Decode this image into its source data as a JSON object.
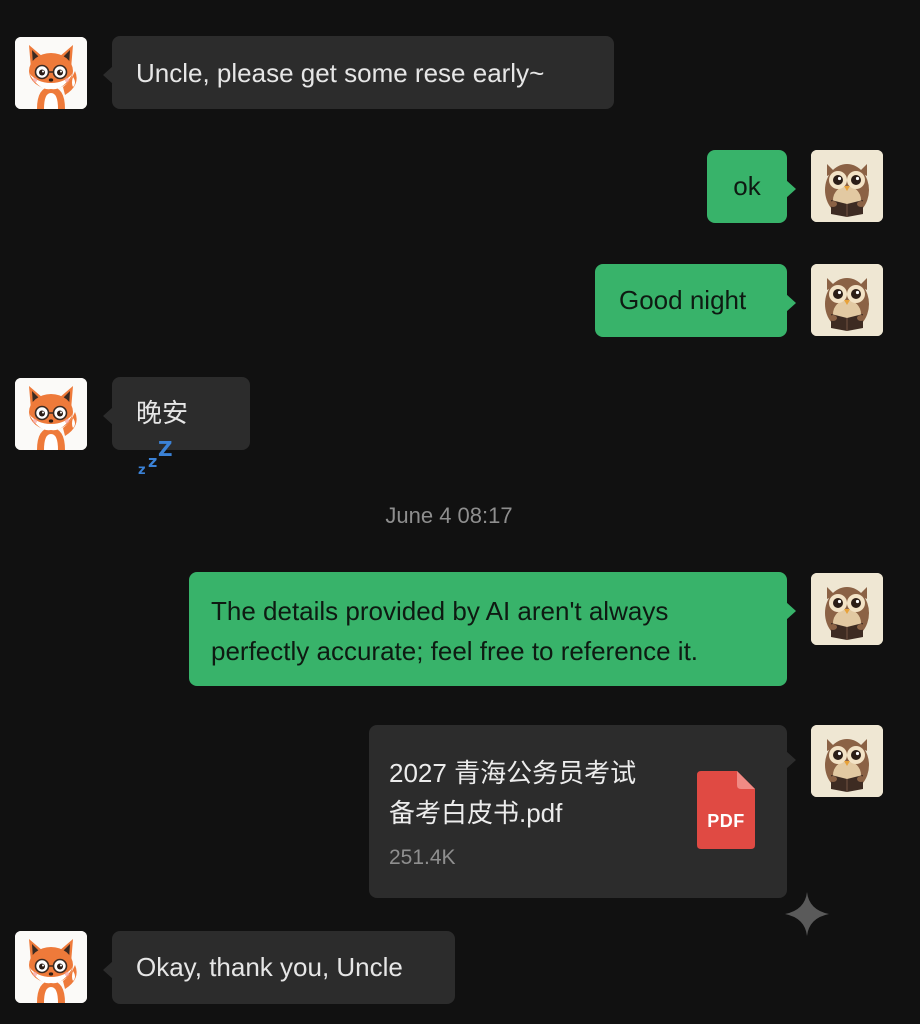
{
  "messages": [
    {
      "side": "in",
      "text": "Uncle, please get some rese early~"
    },
    {
      "side": "out",
      "text": "ok"
    },
    {
      "side": "out",
      "text": "Good night"
    },
    {
      "side": "in",
      "text": "晚安",
      "emoji": "zzz"
    },
    {
      "side": "out",
      "text_lines": [
        "The details provided by AI aren't always",
        "perfectly accurate; feel free to reference it."
      ]
    },
    {
      "side": "out",
      "file": {
        "name_lines": [
          "2027 青海公务员考试",
          "备考白皮书.pdf"
        ],
        "size": "251.4K",
        "type_label": "PDF"
      }
    },
    {
      "side": "in",
      "text": "Okay, thank you, Uncle"
    }
  ],
  "timestamp": "June 4 08:17",
  "zzz": [
    "z",
    "z",
    "Z"
  ],
  "colors": {
    "background": "#111111",
    "incoming_bubble": "#2c2c2c",
    "outgoing_bubble": "#38b36a",
    "pdf_red": "#e04a43",
    "zzz_blue": "#3b82d6"
  },
  "avatars": {
    "contact": "fox-avatar",
    "self": "owl-avatar"
  }
}
